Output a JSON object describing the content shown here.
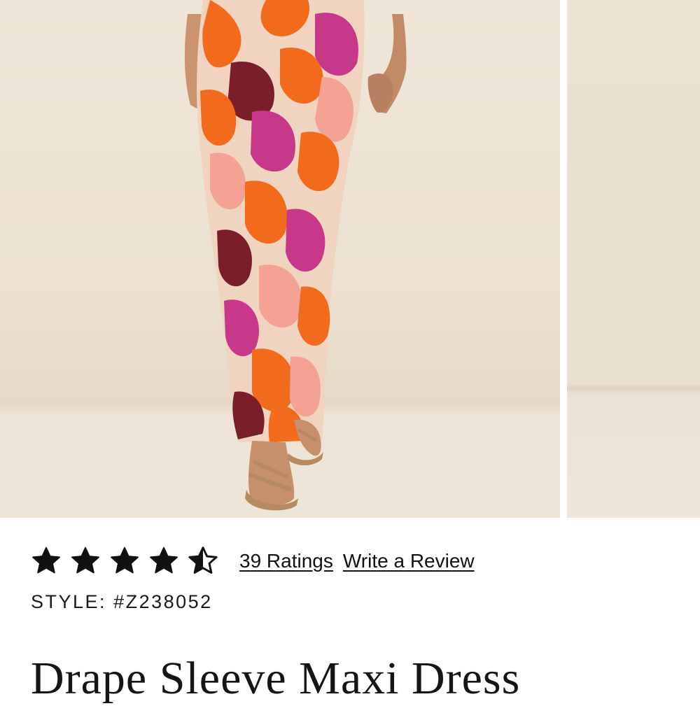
{
  "product": {
    "title": "Drape Sleeve Maxi Dress",
    "style_label": "STYLE:",
    "style_number": "#Z238052"
  },
  "rating": {
    "value": 4.5,
    "max": 5,
    "ratings_link": "39 Ratings",
    "write_review_link": "Write a Review"
  },
  "gallery": {
    "images": [
      {
        "name": "main-product-photo",
        "description": "model wearing orange, pink and magenta floral maxi dress with tan strappy sandals"
      },
      {
        "name": "next-product-photo",
        "description": "partial view of next photo, beige backdrop"
      }
    ]
  },
  "colors": {
    "text": "#111111",
    "backdrop": "#efe6d9",
    "print_orange": "#f26a1b",
    "print_pink": "#f3a293",
    "print_magenta": "#c8388a",
    "print_maroon": "#7a1e2a"
  }
}
